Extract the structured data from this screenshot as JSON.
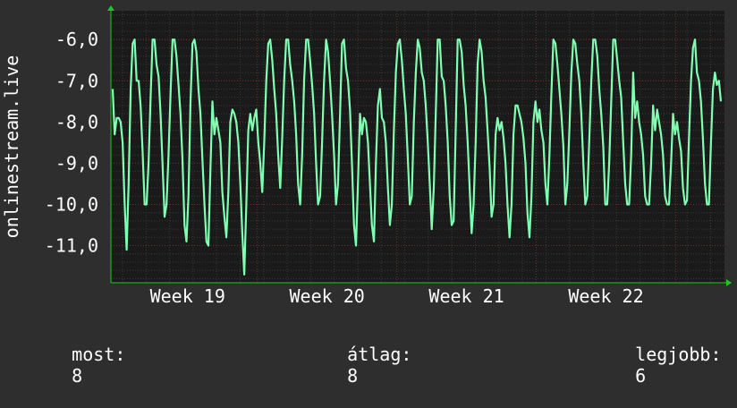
{
  "chart_data": {
    "type": "line",
    "ylabel": "onlinestream.live",
    "ylim": [
      -11.9,
      -5.3
    ],
    "yticks": [
      -6.0,
      -7.0,
      -8.0,
      -9.0,
      -10.0,
      -11.0
    ],
    "ytick_labels": [
      "-6,0",
      "-7,0",
      "-8,0",
      "-9,0",
      "-10,0",
      "-11,0"
    ],
    "xticks": [
      "Week 19",
      "Week 20",
      "Week 21",
      "Week 22"
    ],
    "grid": true,
    "colors": {
      "background": "#2e2e2e",
      "plot_background": "#1a1a1a",
      "line": "#7fffb2",
      "grid_minor": "#3a3a3a",
      "grid_major": "#7a2a2a",
      "axis_arrow": "#1ec81e"
    },
    "series": [
      {
        "values": [
          -7.2,
          -8.3,
          -7.9,
          -7.9,
          -8.0,
          -8.5,
          -10.0,
          -11.1,
          -9.5,
          -7.2,
          -6.1,
          -6.0,
          -7.0,
          -7.0,
          -7.6,
          -8.7,
          -10.0,
          -10.0,
          -9.0,
          -7.4,
          -6.0,
          -6.0,
          -6.6,
          -6.9,
          -7.8,
          -9.0,
          -10.3,
          -10.0,
          -8.8,
          -7.3,
          -6.0,
          -6.0,
          -6.4,
          -7.1,
          -7.8,
          -8.9,
          -10.5,
          -10.9,
          -9.8,
          -7.5,
          -6.1,
          -6.0,
          -6.3,
          -7.2,
          -7.8,
          -8.9,
          -10.0,
          -10.9,
          -11.0,
          -9.2,
          -7.5,
          -8.3,
          -7.9,
          -8.2,
          -8.5,
          -9.7,
          -10.3,
          -10.8,
          -9.7,
          -8.0,
          -7.7,
          -7.8,
          -8.0,
          -8.5,
          -9.5,
          -10.7,
          -11.7,
          -10.0,
          -8.2,
          -7.8,
          -8.2,
          -7.9,
          -7.7,
          -8.5,
          -9.0,
          -9.7,
          -8.5,
          -7.0,
          -6.1,
          -6.0,
          -6.5,
          -7.2,
          -7.8,
          -8.8,
          -9.6,
          -8.4,
          -7.0,
          -6.0,
          -6.0,
          -6.6,
          -7.0,
          -7.5,
          -8.3,
          -9.5,
          -10.0,
          -8.8,
          -7.0,
          -6.0,
          -6.0,
          -6.5,
          -7.1,
          -7.8,
          -9.0,
          -10.0,
          -9.8,
          -8.5,
          -7.0,
          -6.0,
          -6.3,
          -7.0,
          -7.8,
          -8.8,
          -10.0,
          -9.5,
          -7.8,
          -6.1,
          -6.0,
          -6.7,
          -7.0,
          -7.7,
          -9.0,
          -10.5,
          -11.0,
          -9.5,
          -7.8,
          -8.3,
          -7.9,
          -8.0,
          -8.5,
          -9.5,
          -10.5,
          -10.9,
          -9.0,
          -7.6,
          -7.2,
          -7.9,
          -8.0,
          -8.5,
          -9.6,
          -10.5,
          -10.0,
          -8.2,
          -6.8,
          -6.1,
          -6.0,
          -6.5,
          -7.2,
          -7.8,
          -8.9,
          -10.0,
          -9.8,
          -8.0,
          -6.8,
          -6.0,
          -6.2,
          -6.8,
          -7.0,
          -7.6,
          -8.5,
          -9.5,
          -10.6,
          -9.6,
          -7.8,
          -6.0,
          -6.0,
          -6.9,
          -7.0,
          -7.6,
          -8.5,
          -9.8,
          -10.5,
          -10.4,
          -8.2,
          -6.0,
          -6.0,
          -6.3,
          -7.1,
          -7.6,
          -8.5,
          -9.6,
          -10.7,
          -10.0,
          -8.5,
          -6.6,
          -6.0,
          -6.3,
          -7.0,
          -7.4,
          -8.2,
          -9.1,
          -10.3,
          -10.0,
          -8.3,
          -7.9,
          -8.2,
          -8.0,
          -8.4,
          -9.0,
          -10.0,
          -10.8,
          -10.0,
          -8.3,
          -7.6,
          -7.6,
          -7.8,
          -8.0,
          -8.4,
          -9.0,
          -10.2,
          -10.8,
          -9.8,
          -8.0,
          -7.5,
          -8.0,
          -7.7,
          -8.2,
          -8.5,
          -9.5,
          -10.0,
          -8.8,
          -7.3,
          -6.0,
          -6.1,
          -6.6,
          -7.2,
          -7.8,
          -8.6,
          -10.0,
          -9.5,
          -8.2,
          -6.8,
          -6.0,
          -6.1,
          -6.6,
          -7.0,
          -7.8,
          -9.0,
          -10.0,
          -9.8,
          -8.4,
          -7.0,
          -6.0,
          -6.0,
          -6.4,
          -7.2,
          -7.8,
          -8.6,
          -10.0,
          -10.0,
          -9.0,
          -7.5,
          -6.0,
          -6.0,
          -6.5,
          -7.0,
          -7.4,
          -8.5,
          -9.5,
          -10.0,
          -10.0,
          -8.8,
          -6.8,
          -7.9,
          -7.5,
          -8.0,
          -8.3,
          -8.8,
          -9.8,
          -10.0,
          -10.0,
          -9.0,
          -7.6,
          -8.2,
          -7.7,
          -8.0,
          -8.3,
          -8.8,
          -9.8,
          -10.0,
          -10.0,
          -9.0,
          -7.8,
          -8.3,
          -8.0,
          -8.4,
          -8.7,
          -9.6,
          -10.0,
          -9.9,
          -8.4,
          -7.0,
          -6.2,
          -6.0,
          -6.8,
          -7.0,
          -7.5,
          -8.4,
          -9.5,
          -10.0,
          -10.0,
          -8.5,
          -7.2,
          -6.8,
          -7.1,
          -7.0,
          -7.5
        ]
      }
    ]
  },
  "stats": {
    "current_label": "most:",
    "current_value": "8",
    "average_label": "átlag:",
    "average_value": "8",
    "best_label": "legjobb:",
    "best_value": "6"
  }
}
